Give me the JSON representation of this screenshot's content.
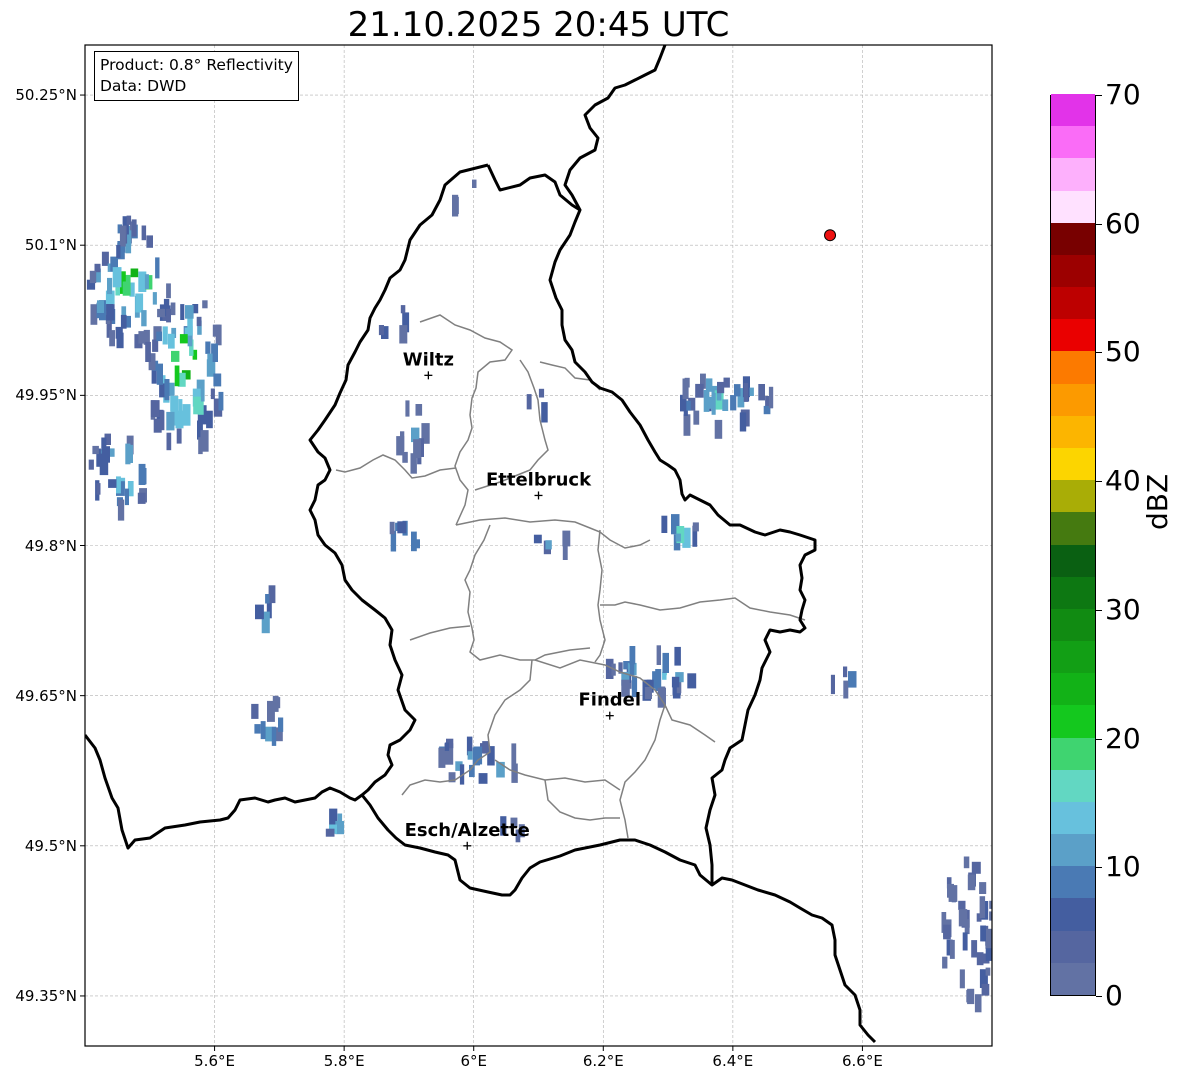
{
  "title": "21.10.2025 20:45 UTC",
  "info": {
    "product": "Product: 0.8° Reflectivity",
    "source": "Data: DWD"
  },
  "axes": {
    "lat_labels": [
      "50.25°N",
      "50.1°N",
      "49.95°N",
      "49.8°N",
      "49.65°N",
      "49.5°N",
      "49.35°N"
    ],
    "lon_labels": [
      "5.6°E",
      "5.8°E",
      "6°E",
      "6.2°E",
      "6.4°E",
      "6.6°E"
    ],
    "lat_values": [
      50.25,
      50.1,
      49.95,
      49.8,
      49.65,
      49.5,
      49.35
    ],
    "lon_values": [
      5.6,
      5.8,
      6.0,
      6.2,
      6.4,
      6.6
    ],
    "lon_range": [
      5.4,
      6.8
    ],
    "lat_range": [
      49.3,
      50.3
    ],
    "grid": true
  },
  "cities": [
    {
      "name": "Wiltz",
      "lon": 5.93,
      "lat": 49.97
    },
    {
      "name": "Ettelbruck",
      "lon": 6.1,
      "lat": 49.85
    },
    {
      "name": "Findel",
      "lon": 6.21,
      "lat": 49.63
    },
    {
      "name": "Esch/Alzette",
      "lon": 5.99,
      "lat": 49.5
    }
  ],
  "radar_site": {
    "lon": 6.55,
    "lat": 50.11,
    "color": "#ee1111"
  },
  "colorbar": {
    "label": "dBZ",
    "ticks": [
      "0",
      "10",
      "20",
      "30",
      "40",
      "50",
      "60",
      "70"
    ],
    "min": 0,
    "max": 70,
    "step": 2.5,
    "colors": [
      "#6272a4",
      "#5566a0",
      "#445ea0",
      "#4a7ab4",
      "#5ba0c8",
      "#67c1dd",
      "#62d7c2",
      "#3fd470",
      "#14c81e",
      "#12b217",
      "#129f15",
      "#118b12",
      "#0d7812",
      "#0a6012",
      "#457a10",
      "#a9ad06",
      "#fcd500",
      "#fcb500",
      "#fc9a00",
      "#fc7a00",
      "#ea0000",
      "#bd0000",
      "#9c0000",
      "#780000",
      "#ffe1ff",
      "#fdb0fc",
      "#fa6cf7",
      "#e233e9"
    ]
  },
  "precip_cells": [
    {
      "lon": 5.47,
      "lat": 50.07,
      "w": 0.14,
      "h": 0.12,
      "dbz": 18
    },
    {
      "lon": 5.55,
      "lat": 49.98,
      "w": 0.12,
      "h": 0.15,
      "dbz": 22
    },
    {
      "lon": 5.45,
      "lat": 49.88,
      "w": 0.09,
      "h": 0.07,
      "dbz": 16
    },
    {
      "lon": 5.87,
      "lat": 50.03,
      "w": 0.04,
      "h": 0.04,
      "dbz": 12
    },
    {
      "lon": 5.9,
      "lat": 49.92,
      "w": 0.04,
      "h": 0.06,
      "dbz": 10
    },
    {
      "lon": 5.89,
      "lat": 49.81,
      "w": 0.05,
      "h": 0.04,
      "dbz": 13
    },
    {
      "lon": 5.67,
      "lat": 49.75,
      "w": 0.03,
      "h": 0.06,
      "dbz": 14
    },
    {
      "lon": 5.68,
      "lat": 49.63,
      "w": 0.06,
      "h": 0.04,
      "dbz": 9
    },
    {
      "lon": 6.0,
      "lat": 49.59,
      "w": 0.14,
      "h": 0.04,
      "dbz": 17
    },
    {
      "lon": 5.78,
      "lat": 49.53,
      "w": 0.05,
      "h": 0.03,
      "dbz": 18
    },
    {
      "lon": 6.38,
      "lat": 49.95,
      "w": 0.16,
      "h": 0.05,
      "dbz": 14
    },
    {
      "lon": 6.31,
      "lat": 49.82,
      "w": 0.06,
      "h": 0.03,
      "dbz": 16
    },
    {
      "lon": 6.12,
      "lat": 49.81,
      "w": 0.06,
      "h": 0.02,
      "dbz": 10
    },
    {
      "lon": 6.27,
      "lat": 49.68,
      "w": 0.14,
      "h": 0.05,
      "dbz": 15
    },
    {
      "lon": 6.56,
      "lat": 49.67,
      "w": 0.05,
      "h": 0.03,
      "dbz": 8
    },
    {
      "lon": 6.76,
      "lat": 49.42,
      "w": 0.08,
      "h": 0.14,
      "dbz": 7
    },
    {
      "lon": 6.05,
      "lat": 49.52,
      "w": 0.06,
      "h": 0.02,
      "dbz": 9
    },
    {
      "lon": 6.1,
      "lat": 49.95,
      "w": 0.05,
      "h": 0.02,
      "dbz": 8
    },
    {
      "lon": 5.98,
      "lat": 50.16,
      "w": 0.04,
      "h": 0.03,
      "dbz": 7
    }
  ]
}
